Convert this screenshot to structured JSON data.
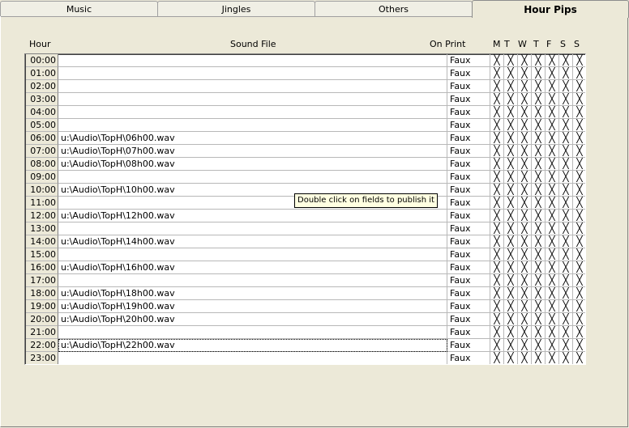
{
  "tabs": [
    {
      "label": "Music",
      "active": false
    },
    {
      "label": "Jingles",
      "active": false
    },
    {
      "label": "Others",
      "active": false
    },
    {
      "label": "Hour Pips",
      "active": true
    }
  ],
  "columns": {
    "hour": "Hour",
    "sound_file": "Sound File",
    "on_print": "On Print",
    "days": [
      "M",
      "T",
      "W",
      "T",
      "F",
      "S",
      "S"
    ]
  },
  "rows": [
    {
      "hour": "00:00",
      "file": "",
      "print": "Faux"
    },
    {
      "hour": "01:00",
      "file": "",
      "print": "Faux"
    },
    {
      "hour": "02:00",
      "file": "",
      "print": "Faux"
    },
    {
      "hour": "03:00",
      "file": "",
      "print": "Faux"
    },
    {
      "hour": "04:00",
      "file": "",
      "print": "Faux"
    },
    {
      "hour": "05:00",
      "file": "",
      "print": "Faux"
    },
    {
      "hour": "06:00",
      "file": "u:\\Audio\\TopH\\06h00.wav",
      "print": "Faux"
    },
    {
      "hour": "07:00",
      "file": "u:\\Audio\\TopH\\07h00.wav",
      "print": "Faux"
    },
    {
      "hour": "08:00",
      "file": "u:\\Audio\\TopH\\08h00.wav",
      "print": "Faux"
    },
    {
      "hour": "09:00",
      "file": "",
      "print": "Faux"
    },
    {
      "hour": "10:00",
      "file": "u:\\Audio\\TopH\\10h00.wav",
      "print": "Faux"
    },
    {
      "hour": "11:00",
      "file": "",
      "print": "Faux"
    },
    {
      "hour": "12:00",
      "file": "u:\\Audio\\TopH\\12h00.wav",
      "print": "Faux"
    },
    {
      "hour": "13:00",
      "file": "",
      "print": "Faux"
    },
    {
      "hour": "14:00",
      "file": "u:\\Audio\\TopH\\14h00.wav",
      "print": "Faux"
    },
    {
      "hour": "15:00",
      "file": "",
      "print": "Faux"
    },
    {
      "hour": "16:00",
      "file": "u:\\Audio\\TopH\\16h00.wav",
      "print": "Faux"
    },
    {
      "hour": "17:00",
      "file": "",
      "print": "Faux"
    },
    {
      "hour": "18:00",
      "file": "u:\\Audio\\TopH\\18h00.wav",
      "print": "Faux"
    },
    {
      "hour": "19:00",
      "file": "u:\\Audio\\TopH\\19h00.wav",
      "print": "Faux"
    },
    {
      "hour": "20:00",
      "file": "u:\\Audio\\TopH\\20h00.wav",
      "print": "Faux"
    },
    {
      "hour": "21:00",
      "file": "",
      "print": "Faux"
    },
    {
      "hour": "22:00",
      "file": "u:\\Audio\\TopH\\22h00.wav",
      "print": "Faux",
      "selected": true
    },
    {
      "hour": "23:00",
      "file": "",
      "print": "Faux"
    }
  ],
  "day_cell_mark": "╳",
  "tooltip": "Double click on fields to publish it"
}
